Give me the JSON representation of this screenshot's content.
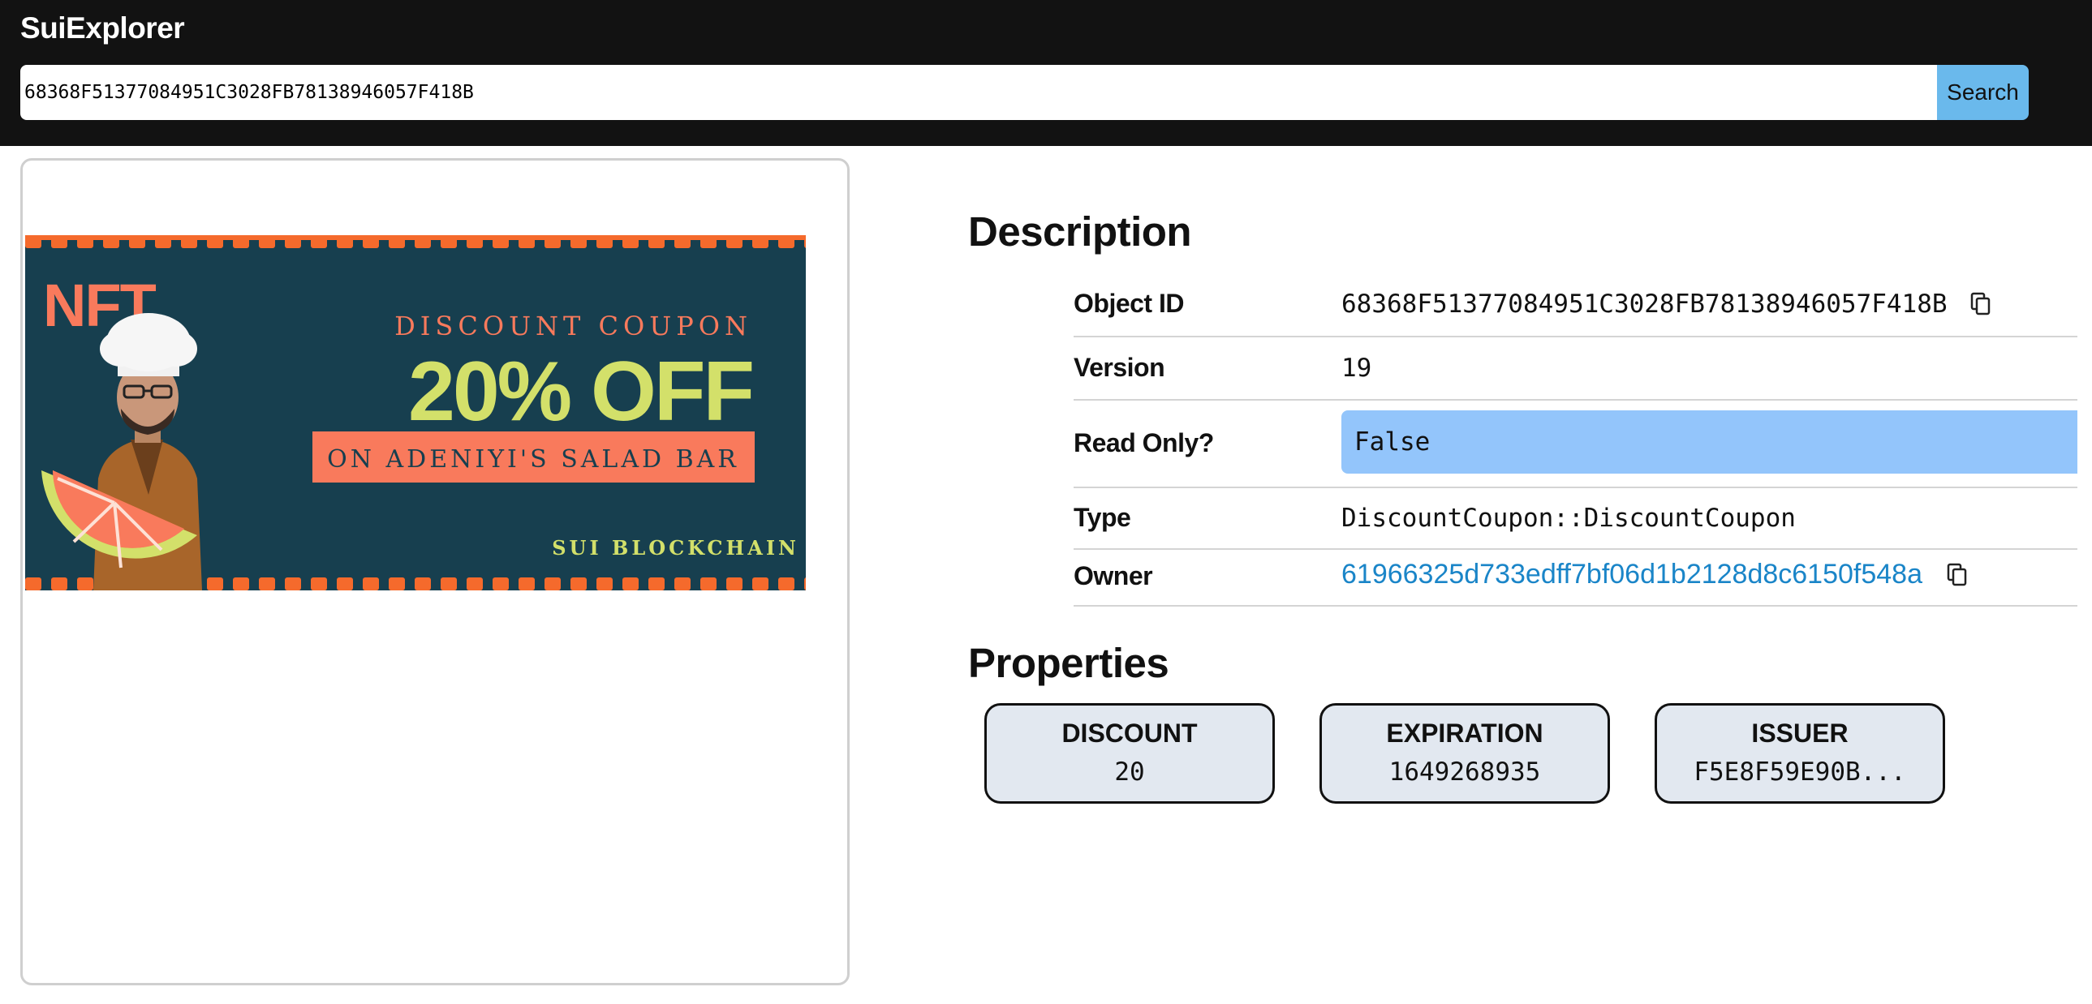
{
  "app": {
    "title": "SuiExplorer"
  },
  "search": {
    "value": "68368F51377084951C3028FB78138946057F418B",
    "button_label": "Search"
  },
  "coupon_image": {
    "nft": "NFT",
    "heading": "DISCOUNT COUPON",
    "offer": "20% OFF",
    "subtitle": "ON ADENIYI'S SALAD BAR",
    "footer": "SUI BLOCKCHAIN",
    "colors": {
      "background": "#173f4f",
      "orange": "#f56a2c",
      "salmon": "#f97a5c",
      "lime": "#d3e06a"
    }
  },
  "description": {
    "title": "Description",
    "rows": [
      {
        "key": "Object ID",
        "value": "68368F51377084951C3028FB78138946057F418B"
      },
      {
        "key": "Version",
        "value": "19"
      },
      {
        "key": "Read Only?",
        "value": "False"
      },
      {
        "key": "Type",
        "value": "DiscountCoupon::DiscountCoupon"
      },
      {
        "key": "Owner",
        "value": "61966325d733edff7bf06d1b2128d8c6150f548a"
      }
    ]
  },
  "properties": {
    "title": "Properties",
    "items": [
      {
        "key": "DISCOUNT",
        "value": "20"
      },
      {
        "key": "EXPIRATION",
        "value": "1649268935"
      },
      {
        "key": "ISSUER",
        "value": "F5E8F59E90B..."
      }
    ]
  },
  "colors": {
    "topbar": "#121212",
    "search_button": "#6ab9ec",
    "readonly_highlight": "#93c5fb",
    "link": "#1a85c8",
    "property_card": "#e2e8f0"
  },
  "icons": {
    "copy": "copy-icon"
  }
}
